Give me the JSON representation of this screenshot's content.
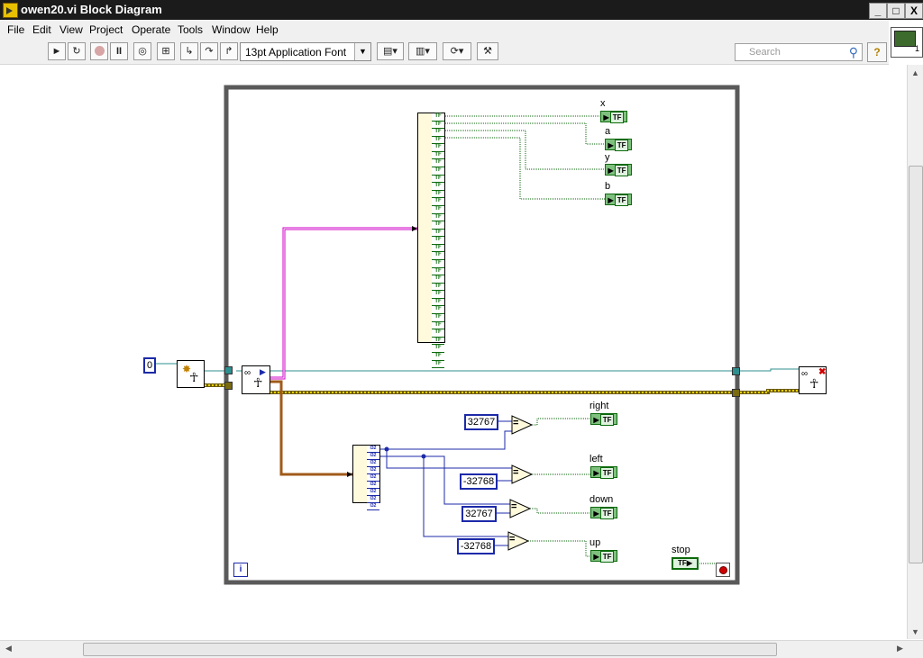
{
  "window": {
    "title": "owen20.vi Block Diagram",
    "minimize_glyph": "_",
    "maximize_glyph": "□",
    "close_glyph": "X"
  },
  "menu": [
    "File",
    "Edit",
    "View",
    "Project",
    "Operate",
    "Tools",
    "Window",
    "Help"
  ],
  "toolbar": {
    "font_selector": "13pt Application Font",
    "search_placeholder": "Search",
    "help_glyph": "?",
    "icons": [
      "run-icon",
      "run-continuously-icon",
      "abort-icon",
      "pause-icon",
      "highlight-execution-icon",
      "retain-wire-values-icon",
      "step-into-icon",
      "step-over-icon",
      "step-out-icon",
      "align-objects-icon",
      "distribute-objects-icon",
      "reorder-icon",
      "clean-up-diagram-icon"
    ]
  },
  "vi_icon": {
    "label": "1"
  },
  "diagram": {
    "constants": {
      "zero": "0",
      "c_right": "32767",
      "c_left": "-32768",
      "c_down": "32767",
      "c_up": "-32768"
    },
    "indicators": {
      "x": "x",
      "a": "a",
      "y": "y",
      "b": "b",
      "right": "right",
      "left": "left",
      "down": "down",
      "up": "up"
    },
    "stop_label": "stop",
    "tf_text": "TF",
    "eq_symbol": "=",
    "iteration_label": "i",
    "i32_text": "I32"
  },
  "colors": {
    "boolean_wire": "#0d6a0d",
    "int_wire": "#1c2aa8",
    "cluster_wire": "#a05a1a",
    "bool_array_wire": "#d000c8",
    "refnum_wire": "#2f8f8f",
    "error_wire": "#c8b000"
  }
}
